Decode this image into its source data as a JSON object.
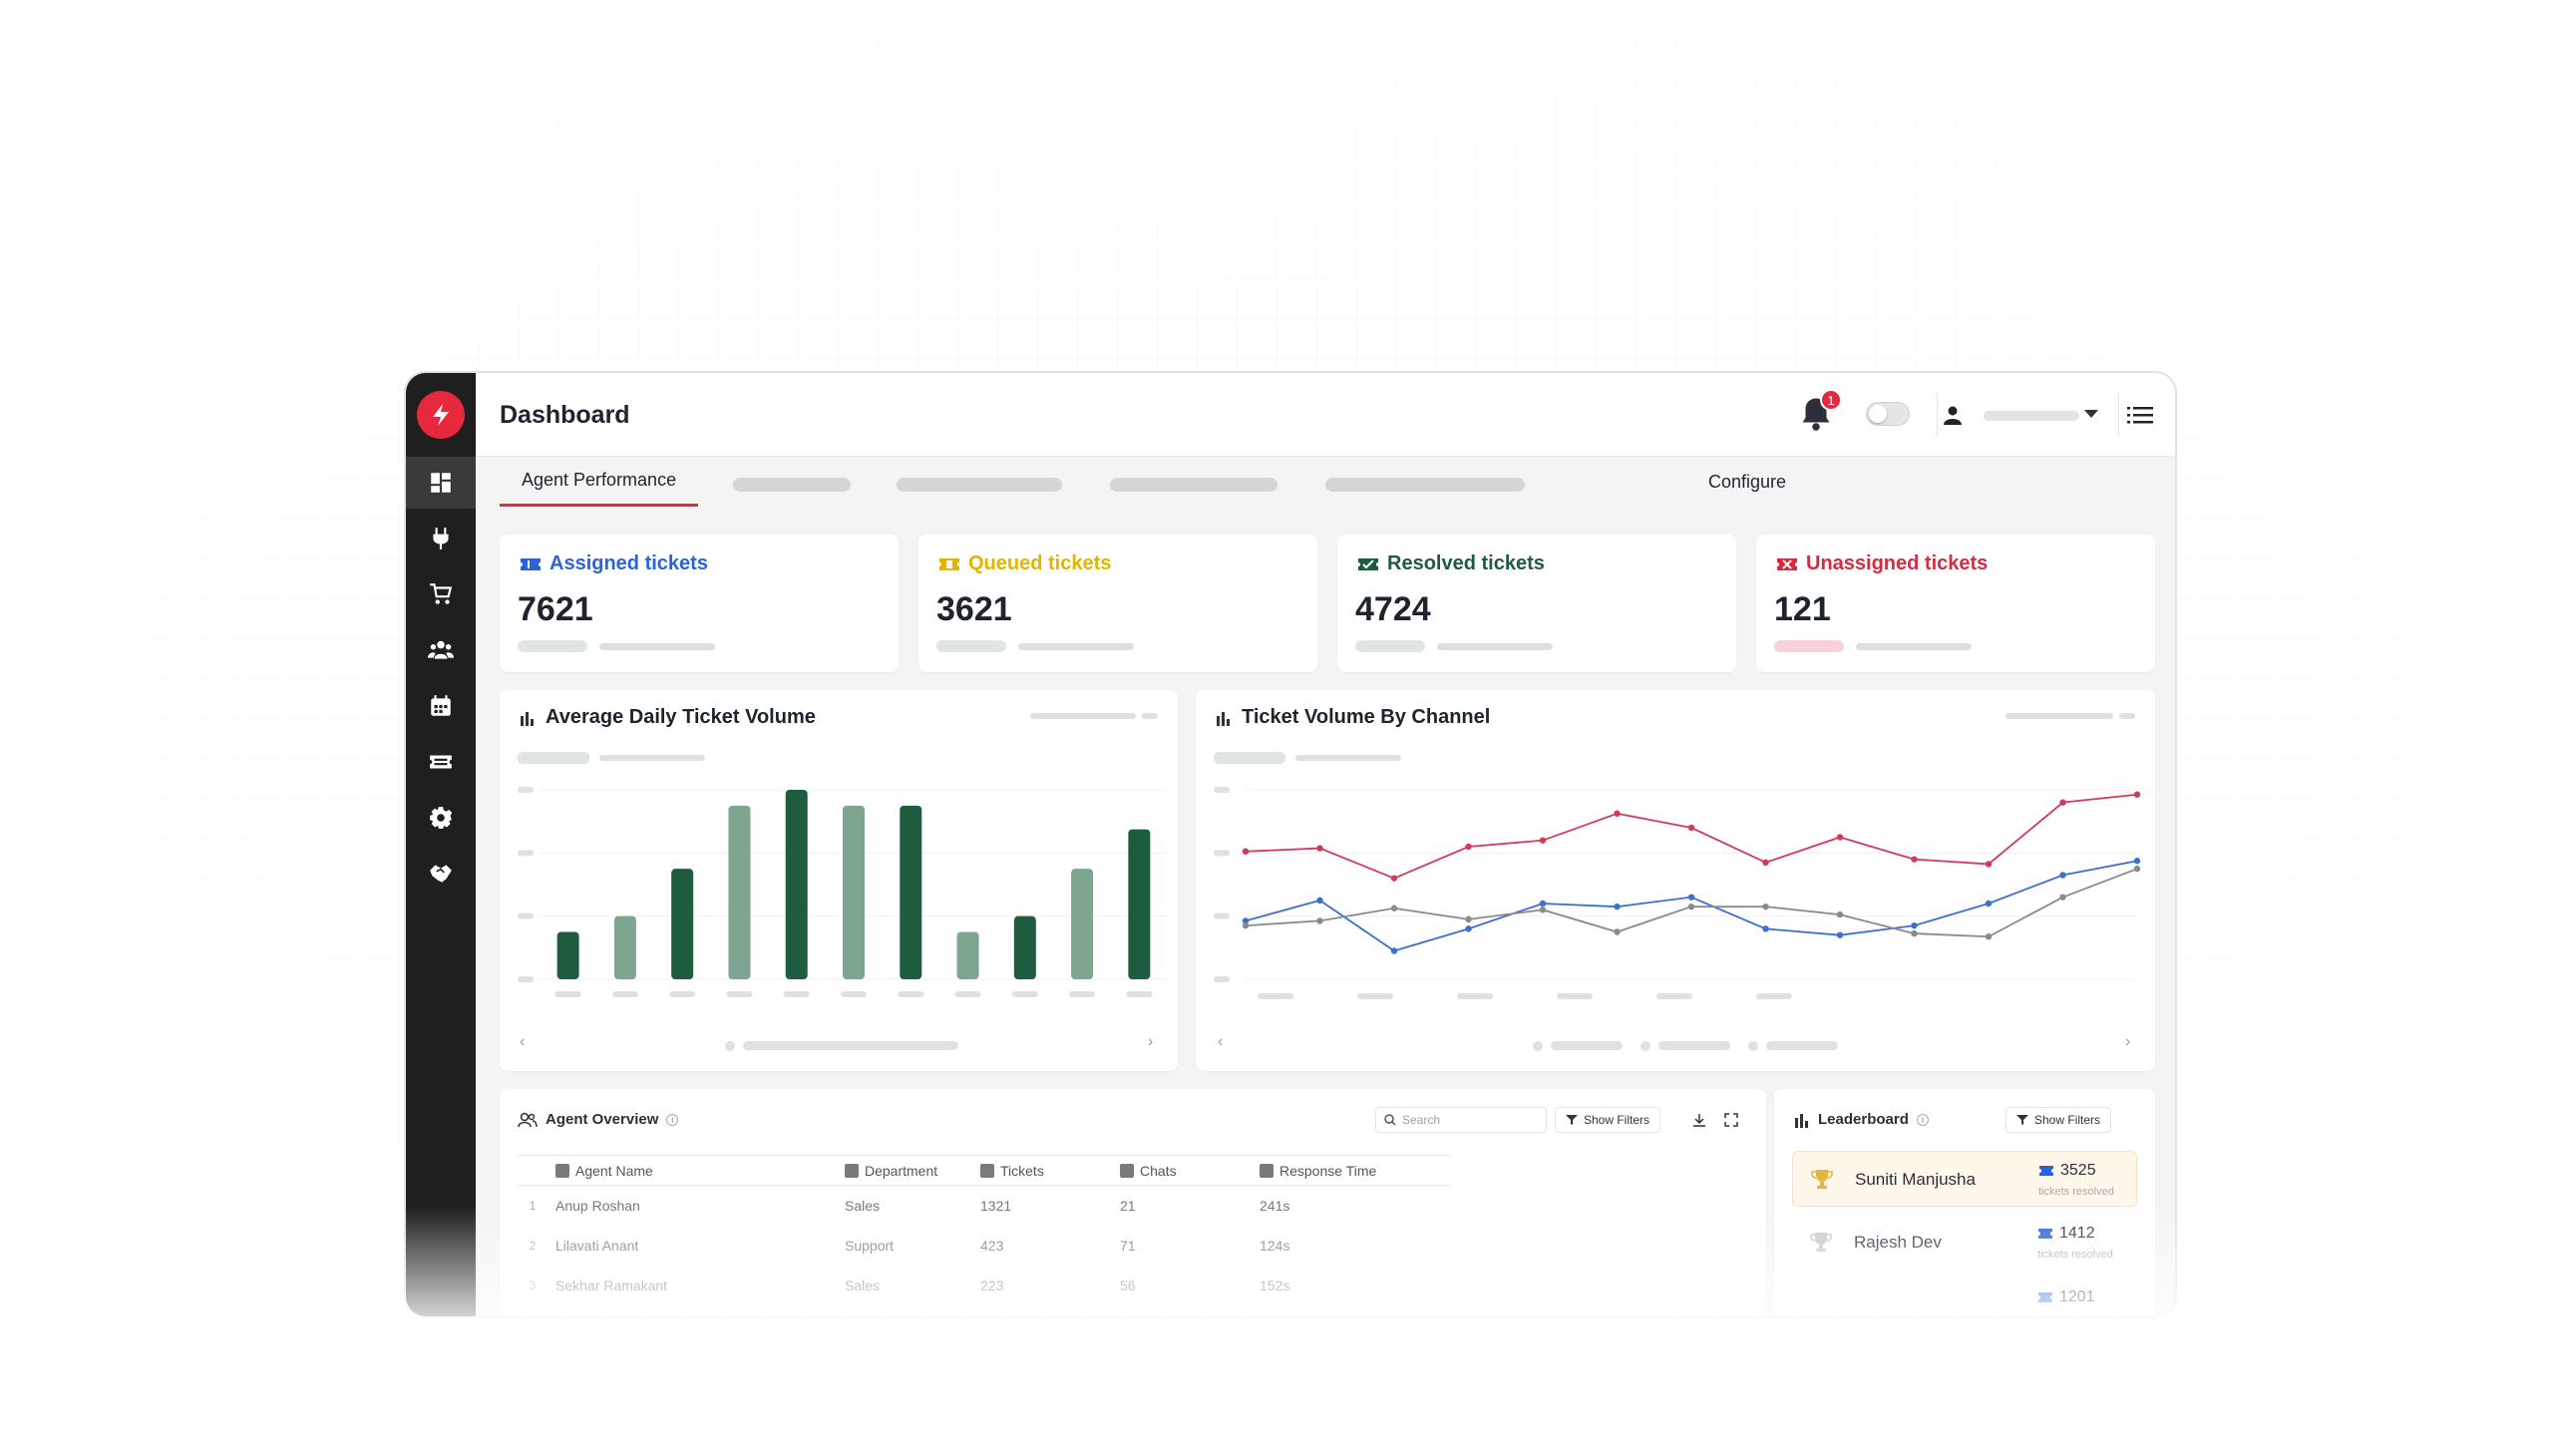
{
  "header": {
    "title": "Dashboard",
    "notification_count": "1"
  },
  "tabs": {
    "active": "Agent Performance",
    "configure": "Configure"
  },
  "stats": [
    {
      "label": "Assigned tickets",
      "value": "7621",
      "color": "#2b63d9",
      "pill": "#dfe6e0"
    },
    {
      "label": "Queued tickets",
      "value": "3621",
      "color": "#e2b400",
      "pill": "#dfe6e0"
    },
    {
      "label": "Resolved tickets",
      "value": "4724",
      "color": "#1e5c3f",
      "pill": "#dfe6e0"
    },
    {
      "label": "Unassigned tickets",
      "value": "121",
      "color": "#d92a3d",
      "pill": "#f7d3d8"
    }
  ],
  "bar_chart_title": "Average Daily Ticket Volume",
  "line_chart_title": "Ticket Volume By Channel",
  "chart_data": [
    {
      "type": "bar",
      "title": "Average Daily Ticket Volume",
      "categories": [
        "",
        "",
        "",
        "",
        "",
        "",
        "",
        "",
        "",
        "",
        ""
      ],
      "values": [
        3,
        4,
        7,
        11,
        12,
        11,
        11,
        3,
        4,
        7,
        9.5
      ],
      "colors": [
        "#1e5c3f",
        "#7ea590",
        "#1e5c3f",
        "#7ea590",
        "#1e5c3f",
        "#7ea590",
        "#1e5c3f",
        "#7ea590",
        "#1e5c3f",
        "#7ea590",
        "#1e5c3f"
      ],
      "ylim": [
        0,
        12
      ],
      "grid": true
    },
    {
      "type": "line",
      "title": "Ticket Volume By Channel",
      "x": [
        1,
        2,
        3,
        4,
        5,
        6,
        7,
        8,
        9,
        10,
        11,
        12,
        13
      ],
      "series": [
        {
          "color": "#d23b57",
          "values": [
            8.1,
            8.3,
            6.4,
            8.4,
            8.8,
            10.5,
            9.6,
            7.4,
            9.0,
            7.6,
            7.3,
            11.2,
            11.7
          ]
        },
        {
          "color": "#3d6fd0",
          "values": [
            3.7,
            5.0,
            1.8,
            3.2,
            4.8,
            4.6,
            5.2,
            3.2,
            2.8,
            3.4,
            4.8,
            6.6,
            7.5
          ]
        },
        {
          "color": "#8a8a8a",
          "values": [
            3.4,
            3.7,
            4.5,
            3.8,
            4.4,
            3.0,
            4.6,
            4.6,
            4.1,
            2.9,
            2.7,
            5.2,
            7.0
          ]
        }
      ],
      "ylim": [
        0,
        12
      ],
      "grid": true
    }
  ],
  "agent_overview": {
    "title": "Agent Overview",
    "search_placeholder": "Search",
    "filter_label": "Show Filters",
    "columns": [
      "Agent Name",
      "Department",
      "Tickets",
      "Chats",
      "Response Time"
    ],
    "rows": [
      {
        "idx": "1",
        "name": "Anup Roshan",
        "department": "Sales",
        "tickets": "1321",
        "chats": "21",
        "response": "241s"
      },
      {
        "idx": "2",
        "name": "Lilavati Anant",
        "department": "Support",
        "tickets": "423",
        "chats": "71",
        "response": "124s"
      },
      {
        "idx": "3",
        "name": "Sekhar Ramakant",
        "department": "Sales",
        "tickets": "223",
        "chats": "56",
        "response": "152s"
      }
    ]
  },
  "leaderboard": {
    "title": "Leaderboard",
    "filter_label": "Show Filters",
    "entries": [
      {
        "name": "Suniti Manjusha",
        "count": "3525",
        "sub": "tickets resolved"
      },
      {
        "name": "Rajesh Dev",
        "count": "1412",
        "sub": "tickets resolved"
      },
      {
        "name": "",
        "count": "1201",
        "sub": ""
      }
    ]
  }
}
